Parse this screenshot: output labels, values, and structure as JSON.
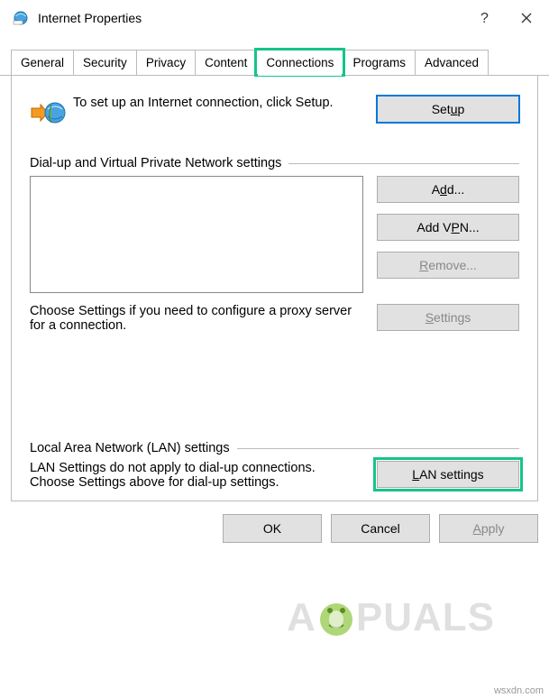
{
  "window": {
    "title": "Internet Properties"
  },
  "tabs": {
    "items": [
      "General",
      "Security",
      "Privacy",
      "Content",
      "Connections",
      "Programs",
      "Advanced"
    ],
    "selected_index": 4
  },
  "setup": {
    "text": "To set up an Internet connection, click Setup.",
    "button": "Setup"
  },
  "dialup": {
    "heading": "Dial-up and Virtual Private Network settings",
    "buttons": {
      "add": "Add...",
      "add_vpn": "Add VPN...",
      "remove": "Remove...",
      "settings": "Settings"
    },
    "proxy_text": "Choose Settings if you need to configure a proxy server for a connection."
  },
  "lan": {
    "heading": "Local Area Network (LAN) settings",
    "text": "LAN Settings do not apply to dial-up connections. Choose Settings above for dial-up settings.",
    "button": "LAN settings"
  },
  "dialog_buttons": {
    "ok": "OK",
    "cancel": "Cancel",
    "apply": "Apply"
  },
  "watermark": {
    "prefix": "A",
    "suffix": "PUALS"
  },
  "brand": "wsxdn.com"
}
